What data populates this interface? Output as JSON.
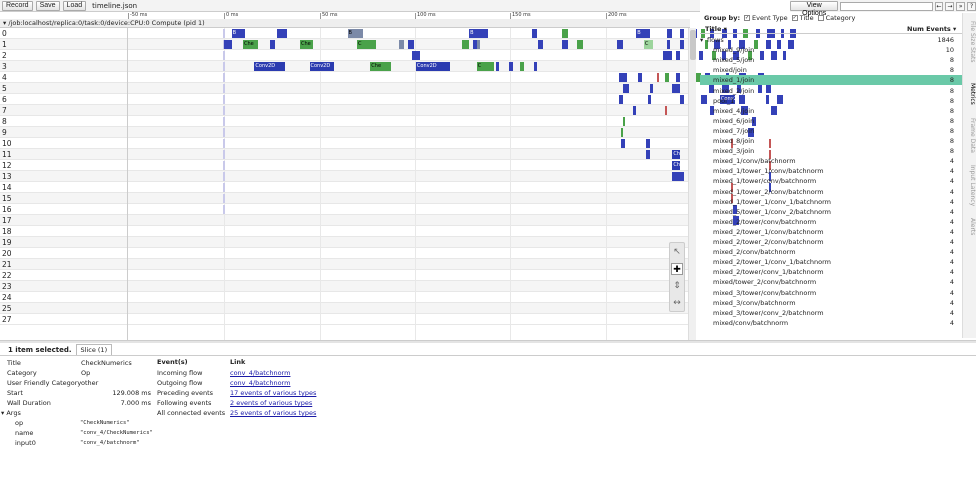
{
  "toolbar": {
    "record": "Record",
    "save": "Save",
    "load": "Load",
    "filename": "timeline.json"
  },
  "topright": {
    "view_options": "View Options",
    "nav_prev": "←",
    "nav_next": "→",
    "nav_all": "»",
    "help": "?"
  },
  "process": {
    "header": "/job:localhost/replica:0/task:0/device:CPU:0 Compute (pid 1)"
  },
  "ruler": {
    "ticks": [
      "-50 ms",
      "0 ms",
      "50 ms",
      "100 ms",
      "150 ms",
      "200 ms"
    ]
  },
  "rows": [
    "0",
    "1",
    "2",
    "3",
    "4",
    "5",
    "6",
    "7",
    "8",
    "9",
    "10",
    "11",
    "12",
    "13",
    "14",
    "15",
    "16",
    "17",
    "18",
    "19",
    "20",
    "21",
    "22",
    "23",
    "24",
    "25",
    "27"
  ],
  "slices": [
    {
      "r": 0,
      "t": 4,
      "w": 7,
      "c": "blue",
      "l": "B"
    },
    {
      "r": 0,
      "t": 28,
      "w": 5,
      "c": "blue",
      "l": ""
    },
    {
      "r": 0,
      "t": 65,
      "w": 8,
      "c": "gray",
      "l": "B"
    },
    {
      "r": 0,
      "t": 129,
      "w": 10,
      "c": "blue",
      "l": "B"
    },
    {
      "r": 0,
      "t": 162,
      "w": 3,
      "c": "blue",
      "l": ""
    },
    {
      "r": 0,
      "t": 178,
      "w": 3,
      "c": "green",
      "l": ""
    },
    {
      "r": 0,
      "t": 217,
      "w": 7,
      "c": "blue",
      "l": "B"
    },
    {
      "r": 0,
      "t": 233,
      "w": 3,
      "c": "blue",
      "l": ""
    },
    {
      "r": 0,
      "t": 240,
      "w": 2,
      "c": "blue",
      "l": ""
    },
    {
      "r": 0,
      "t": 247,
      "w": 2,
      "c": "blue",
      "l": ""
    },
    {
      "r": 0,
      "t": 251,
      "w": 2,
      "c": "green",
      "l": ""
    },
    {
      "r": 0,
      "t": 256,
      "w": 2,
      "c": "blue",
      "l": ""
    },
    {
      "r": 0,
      "t": 262,
      "w": 3,
      "c": "blue",
      "l": ""
    },
    {
      "r": 0,
      "t": 268,
      "w": 2,
      "c": "blue",
      "l": ""
    },
    {
      "r": 0,
      "t": 273,
      "w": 3,
      "c": "green",
      "l": ""
    },
    {
      "r": 0,
      "t": 280,
      "w": 2,
      "c": "blue",
      "l": ""
    },
    {
      "r": 0,
      "t": 286,
      "w": 4,
      "c": "blue",
      "l": ""
    },
    {
      "r": 0,
      "t": 293,
      "w": 2,
      "c": "blue",
      "l": ""
    },
    {
      "r": 0,
      "t": 298,
      "w": 3,
      "c": "blue",
      "l": ""
    },
    {
      "r": 1,
      "t": 0,
      "w": 4,
      "c": "blue",
      "l": ""
    },
    {
      "r": 1,
      "t": 10,
      "w": 8,
      "c": "green",
      "l": "Che"
    },
    {
      "r": 1,
      "t": 24,
      "w": 3,
      "c": "blue",
      "l": ""
    },
    {
      "r": 1,
      "t": 40,
      "w": 7,
      "c": "green",
      "l": "Che"
    },
    {
      "r": 1,
      "t": 70,
      "w": 10,
      "c": "green",
      "l": "C"
    },
    {
      "r": 1,
      "t": 92,
      "w": 3,
      "c": "gray",
      "l": ""
    },
    {
      "r": 1,
      "t": 97,
      "w": 3,
      "c": "blue",
      "l": ""
    },
    {
      "r": 1,
      "t": 125,
      "w": 4,
      "c": "green",
      "l": ""
    },
    {
      "r": 1,
      "t": 131,
      "w": 3,
      "c": "blue",
      "l": ""
    },
    {
      "r": 1,
      "t": 133,
      "w": 2,
      "c": "gray",
      "l": ""
    },
    {
      "r": 1,
      "t": 165,
      "w": 3,
      "c": "blue",
      "l": ""
    },
    {
      "r": 1,
      "t": 178,
      "w": 3,
      "c": "blue",
      "l": ""
    },
    {
      "r": 1,
      "t": 186,
      "w": 3,
      "c": "green",
      "l": ""
    },
    {
      "r": 1,
      "t": 207,
      "w": 3,
      "c": "blue",
      "l": ""
    },
    {
      "r": 1,
      "t": 221,
      "w": 5,
      "c": "lgreen",
      "l": "C"
    },
    {
      "r": 1,
      "t": 233,
      "w": 2,
      "c": "blue",
      "l": ""
    },
    {
      "r": 1,
      "t": 240,
      "w": 2,
      "c": "blue",
      "l": ""
    },
    {
      "r": 1,
      "t": 246,
      "w": 2,
      "c": "blue",
      "l": ""
    },
    {
      "r": 1,
      "t": 253,
      "w": 2,
      "c": "green",
      "l": ""
    },
    {
      "r": 1,
      "t": 258,
      "w": 3,
      "c": "blue",
      "l": ""
    },
    {
      "r": 1,
      "t": 265,
      "w": 2,
      "c": "blue",
      "l": ""
    },
    {
      "r": 1,
      "t": 271,
      "w": 3,
      "c": "blue",
      "l": ""
    },
    {
      "r": 1,
      "t": 279,
      "w": 2,
      "c": "green",
      "l": ""
    },
    {
      "r": 1,
      "t": 285,
      "w": 3,
      "c": "blue",
      "l": ""
    },
    {
      "r": 1,
      "t": 291,
      "w": 2,
      "c": "blue",
      "l": ""
    },
    {
      "r": 1,
      "t": 297,
      "w": 3,
      "c": "blue",
      "l": ""
    },
    {
      "r": 2,
      "t": 99,
      "w": 4,
      "c": "blue",
      "l": ""
    },
    {
      "r": 2,
      "t": 231,
      "w": 5,
      "c": "blue",
      "l": ""
    },
    {
      "r": 2,
      "t": 238,
      "w": 2,
      "c": "blue",
      "l": ""
    },
    {
      "r": 2,
      "t": 244,
      "w": 2,
      "c": "blue",
      "l": ""
    },
    {
      "r": 2,
      "t": 250,
      "w": 2,
      "c": "blue",
      "l": ""
    },
    {
      "r": 2,
      "t": 257,
      "w": 2,
      "c": "green",
      "l": ""
    },
    {
      "r": 2,
      "t": 262,
      "w": 2,
      "c": "blue",
      "l": ""
    },
    {
      "r": 2,
      "t": 268,
      "w": 3,
      "c": "blue",
      "l": ""
    },
    {
      "r": 2,
      "t": 276,
      "w": 2,
      "c": "green",
      "l": ""
    },
    {
      "r": 2,
      "t": 282,
      "w": 2,
      "c": "blue",
      "l": ""
    },
    {
      "r": 2,
      "t": 288,
      "w": 3,
      "c": "blue",
      "l": ""
    },
    {
      "r": 2,
      "t": 294,
      "w": 2,
      "c": "blue",
      "l": ""
    },
    {
      "r": 3,
      "t": 16,
      "w": 16,
      "c": "blue2",
      "l": "Conv2D"
    },
    {
      "r": 3,
      "t": 45,
      "w": 13,
      "c": "blue2",
      "l": "Conv2D"
    },
    {
      "r": 3,
      "t": 77,
      "w": 11,
      "c": "green",
      "l": "Che"
    },
    {
      "r": 3,
      "t": 101,
      "w": 18,
      "c": "blue2",
      "l": "Conv2D"
    },
    {
      "r": 3,
      "t": 133,
      "w": 9,
      "c": "green",
      "l": "C"
    },
    {
      "r": 3,
      "t": 143,
      "w": 2,
      "c": "blue",
      "l": ""
    },
    {
      "r": 3,
      "t": 150,
      "w": 2,
      "c": "blue",
      "l": ""
    },
    {
      "r": 3,
      "t": 156,
      "w": 2,
      "c": "green",
      "l": ""
    },
    {
      "r": 3,
      "t": 163,
      "w": 2,
      "c": "blue",
      "l": ""
    },
    {
      "r": 4,
      "t": 208,
      "w": 2,
      "c": "blue",
      "l": ""
    },
    {
      "r": 4,
      "t": 210,
      "w": 2,
      "c": "blue",
      "l": ""
    },
    {
      "r": 4,
      "t": 218,
      "w": 2,
      "c": "blue",
      "l": ""
    },
    {
      "r": 4,
      "t": 228,
      "w": 1,
      "c": "red",
      "l": ""
    },
    {
      "r": 4,
      "t": 232,
      "w": 2,
      "c": "green",
      "l": ""
    },
    {
      "r": 4,
      "t": 238,
      "w": 2,
      "c": "blue",
      "l": ""
    },
    {
      "r": 4,
      "t": 248,
      "w": 3,
      "c": "green",
      "l": ""
    },
    {
      "r": 4,
      "t": 253,
      "w": 3,
      "c": "blue",
      "l": ""
    },
    {
      "r": 4,
      "t": 264,
      "w": 2,
      "c": "blue",
      "l": ""
    },
    {
      "r": 4,
      "t": 271,
      "w": 4,
      "c": "blue",
      "l": ""
    },
    {
      "r": 4,
      "t": 281,
      "w": 3,
      "c": "blue",
      "l": ""
    },
    {
      "r": 5,
      "t": 210,
      "w": 3,
      "c": "blue",
      "l": ""
    },
    {
      "r": 5,
      "t": 224,
      "w": 2,
      "c": "blue",
      "l": ""
    },
    {
      "r": 5,
      "t": 236,
      "w": 4,
      "c": "blue",
      "l": ""
    },
    {
      "r": 5,
      "t": 255,
      "w": 3,
      "c": "blue",
      "l": ""
    },
    {
      "r": 5,
      "t": 262,
      "w": 4,
      "c": "blue",
      "l": ""
    },
    {
      "r": 5,
      "t": 270,
      "w": 2,
      "c": "blue",
      "l": ""
    },
    {
      "r": 5,
      "t": 281,
      "w": 2,
      "c": "blue",
      "l": ""
    },
    {
      "r": 5,
      "t": 285,
      "w": 3,
      "c": "blue",
      "l": ""
    },
    {
      "r": 6,
      "t": 208,
      "w": 2,
      "c": "blue",
      "l": ""
    },
    {
      "r": 6,
      "t": 223,
      "w": 2,
      "c": "blue",
      "l": ""
    },
    {
      "r": 6,
      "t": 240,
      "w": 2,
      "c": "blue",
      "l": ""
    },
    {
      "r": 6,
      "t": 251,
      "w": 3,
      "c": "blue",
      "l": ""
    },
    {
      "r": 6,
      "t": 261,
      "w": 8,
      "c": "blue2",
      "l": "Conv2D"
    },
    {
      "r": 6,
      "t": 271,
      "w": 3,
      "c": "blue",
      "l": ""
    },
    {
      "r": 6,
      "t": 285,
      "w": 2,
      "c": "blue",
      "l": ""
    },
    {
      "r": 6,
      "t": 291,
      "w": 3,
      "c": "blue",
      "l": ""
    },
    {
      "r": 7,
      "t": 215,
      "w": 2,
      "c": "blue",
      "l": ""
    },
    {
      "r": 7,
      "t": 232,
      "w": 1,
      "c": "red",
      "l": ""
    },
    {
      "r": 7,
      "t": 244,
      "w": 4,
      "c": "blue",
      "l": ""
    },
    {
      "r": 7,
      "t": 256,
      "w": 2,
      "c": "blue",
      "l": ""
    },
    {
      "r": 7,
      "t": 272,
      "w": 4,
      "c": "blue",
      "l": ""
    },
    {
      "r": 7,
      "t": 288,
      "w": 3,
      "c": "blue",
      "l": ""
    },
    {
      "r": 8,
      "t": 210,
      "w": 1,
      "c": "green",
      "l": ""
    },
    {
      "r": 8,
      "t": 278,
      "w": 2,
      "c": "blue",
      "l": ""
    },
    {
      "r": 9,
      "t": 209,
      "w": 1,
      "c": "green",
      "l": ""
    },
    {
      "r": 9,
      "t": 276,
      "w": 3,
      "c": "blue",
      "l": ""
    },
    {
      "r": 10,
      "t": 209,
      "w": 2,
      "c": "blue",
      "l": ""
    },
    {
      "r": 10,
      "t": 222,
      "w": 2,
      "c": "blue",
      "l": ""
    },
    {
      "r": 10,
      "t": 267,
      "w": 1,
      "c": "red",
      "l": ""
    },
    {
      "r": 10,
      "t": 287,
      "w": 1,
      "c": "red",
      "l": ""
    },
    {
      "r": 11,
      "t": 222,
      "w": 2,
      "c": "blue",
      "l": ""
    },
    {
      "r": 11,
      "t": 236,
      "w": 4,
      "c": "blue2",
      "l": "Ch"
    },
    {
      "r": 11,
      "t": 287,
      "w": 1,
      "c": "red",
      "l": ""
    },
    {
      "r": 12,
      "t": 236,
      "w": 4,
      "c": "blue2",
      "l": "Ch"
    },
    {
      "r": 12,
      "t": 287,
      "w": 1,
      "c": "red",
      "l": ""
    },
    {
      "r": 13,
      "t": 236,
      "w": 6,
      "c": "blue",
      "l": ""
    },
    {
      "r": 13,
      "t": 287,
      "w": 1,
      "c": "blue",
      "l": ""
    },
    {
      "r": 14,
      "t": 267,
      "w": 1,
      "c": "red",
      "l": ""
    },
    {
      "r": 14,
      "t": 287,
      "w": 1,
      "c": "blue",
      "l": ""
    },
    {
      "r": 15,
      "t": 267,
      "w": 1,
      "c": "red",
      "l": ""
    },
    {
      "r": 16,
      "t": 268,
      "w": 2,
      "c": "blue",
      "l": ""
    },
    {
      "r": 17,
      "t": 268,
      "w": 3,
      "c": "blue",
      "l": ""
    }
  ],
  "right_panel": {
    "group_by": "Group by:",
    "opt_event_type": "Event Type",
    "opt_title": "Title",
    "opt_category": "Category",
    "col_title": "Title",
    "col_num": "Num Events",
    "items": [
      {
        "name": "flows",
        "val": "1846",
        "root": true
      },
      {
        "name": "mixed_9/join",
        "val": "10"
      },
      {
        "name": "mixed_5/join",
        "val": "8"
      },
      {
        "name": "mixed/join",
        "val": "8"
      },
      {
        "name": "mixed_1/join",
        "val": "8",
        "sel": true
      },
      {
        "name": "mixed_2/join",
        "val": "8"
      },
      {
        "name": "pool_1",
        "val": "8"
      },
      {
        "name": "mixed_4/join",
        "val": "8"
      },
      {
        "name": "mixed_6/join",
        "val": "8"
      },
      {
        "name": "mixed_7/join",
        "val": "8"
      },
      {
        "name": "mixed_8/join",
        "val": "8"
      },
      {
        "name": "mixed_3/join",
        "val": "8"
      },
      {
        "name": "mixed_1/conv/batchnorm",
        "val": "4"
      },
      {
        "name": "mixed_1/tower_1/conv/batchnorm",
        "val": "4"
      },
      {
        "name": "mixed_1/tower/conv/batchnorm",
        "val": "4"
      },
      {
        "name": "mixed_1/tower_2/conv/batchnorm",
        "val": "4"
      },
      {
        "name": "mixed_1/tower_1/conv_1/batchnorm",
        "val": "4"
      },
      {
        "name": "mixed_5/tower_1/conv_2/batchnorm",
        "val": "4"
      },
      {
        "name": "mixed_2/tower/conv/batchnorm",
        "val": "4"
      },
      {
        "name": "mixed_2/tower_1/conv/batchnorm",
        "val": "4"
      },
      {
        "name": "mixed_2/tower_2/conv/batchnorm",
        "val": "4"
      },
      {
        "name": "mixed_2/conv/batchnorm",
        "val": "4"
      },
      {
        "name": "mixed_2/tower_1/conv_1/batchnorm",
        "val": "4"
      },
      {
        "name": "mixed_2/tower/conv_1/batchnorm",
        "val": "4"
      },
      {
        "name": "mixed/tower_2/conv/batchnorm",
        "val": "4"
      },
      {
        "name": "mixed_3/tower/conv/batchnorm",
        "val": "4"
      },
      {
        "name": "mixed_3/conv/batchnorm",
        "val": "4"
      },
      {
        "name": "mixed_3/tower/conv_2/batchnorm",
        "val": "4"
      },
      {
        "name": "mixed/conv/batchnorm",
        "val": "4"
      }
    ]
  },
  "side_tabs": [
    "File Size Stats",
    "Metrics",
    "Frame Data",
    "Input Latency",
    "Alerts"
  ],
  "analysis": {
    "selected": "1 item selected.",
    "slice_tab": "Slice (1)",
    "title_k": "Title",
    "title_v": "CheckNumerics",
    "category_k": "Category",
    "category_v": "Op",
    "ufc_k": "User Friendly Category",
    "ufc_v": "other",
    "start_k": "Start",
    "start_v": "129.008 ms",
    "wall_k": "Wall Duration",
    "wall_v": "7.000 ms",
    "args_k": "Args",
    "op_k": "op",
    "op_v": "\"CheckNumerics\"",
    "name_k": "name",
    "name_v": "\"conv_4/CheckNumerics\"",
    "input_k": "input0",
    "input_v": "\"conv_4/batchnorm\"",
    "events_head": "Event(s)",
    "link_head": "Link",
    "events": [
      {
        "e": "Incoming flow",
        "l": "conv_4/batchnorm"
      },
      {
        "e": "Outgoing flow",
        "l": "conv_4/batchnorm"
      },
      {
        "e": "Preceding events",
        "l": "17 events of various types"
      },
      {
        "e": "Following events",
        "l": "2 events of various types"
      },
      {
        "e": "All connected events",
        "l": "25 events of various types"
      }
    ]
  }
}
